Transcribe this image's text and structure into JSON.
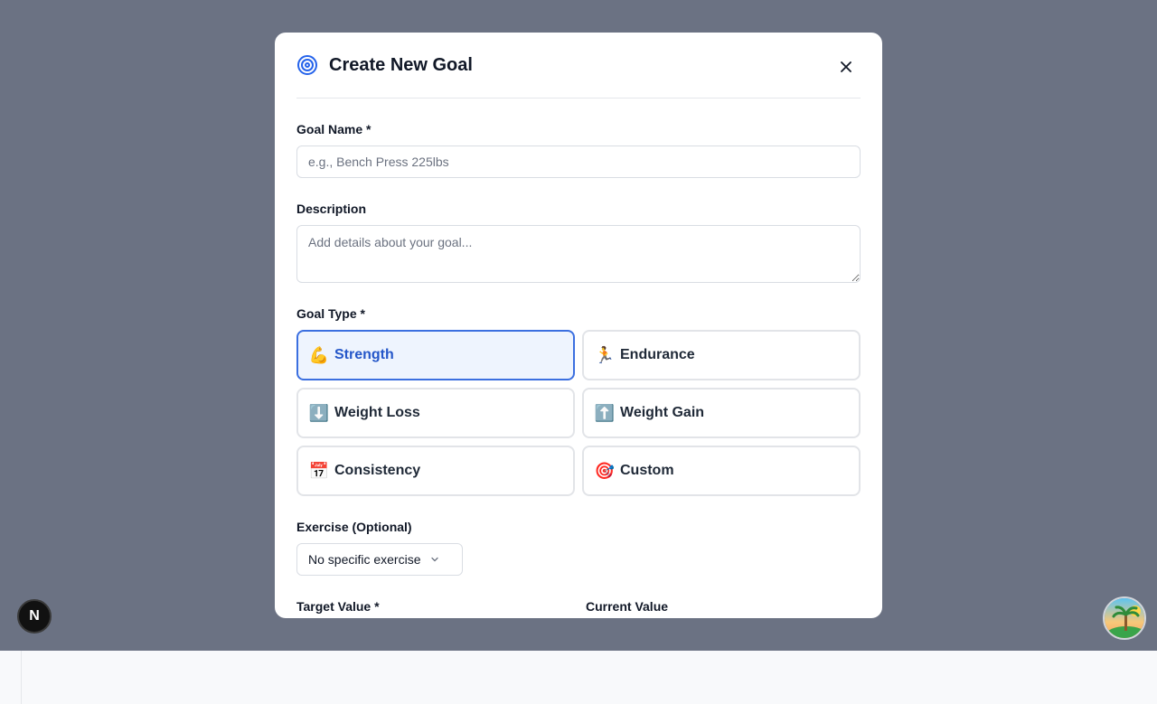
{
  "modal": {
    "title": "Create New Goal",
    "close_icon": "close-icon",
    "header_icon": "target-icon"
  },
  "form": {
    "goal_name": {
      "label": "Goal Name *",
      "placeholder": "e.g., Bench Press 225lbs",
      "value": ""
    },
    "description": {
      "label": "Description",
      "placeholder": "Add details about your goal...",
      "value": ""
    },
    "goal_type": {
      "label": "Goal Type *",
      "selected": "Strength",
      "options": [
        {
          "emoji": "💪",
          "label": "Strength"
        },
        {
          "emoji": "🏃",
          "label": "Endurance"
        },
        {
          "emoji": "⬇️",
          "label": "Weight Loss"
        },
        {
          "emoji": "⬆️",
          "label": "Weight Gain"
        },
        {
          "emoji": "📅",
          "label": "Consistency"
        },
        {
          "emoji": "🎯",
          "label": "Custom"
        }
      ]
    },
    "exercise": {
      "label": "Exercise (Optional)",
      "value": "No specific exercise"
    },
    "target_value": {
      "label": "Target Value *"
    },
    "current_value": {
      "label": "Current Value"
    }
  },
  "floating": {
    "nextjs_label": "N",
    "avatar_icon": "avatar-island-icon"
  },
  "colors": {
    "overlay": "#6b7283",
    "accent": "#3b6fe0",
    "selected_bg": "#eef4fe"
  }
}
